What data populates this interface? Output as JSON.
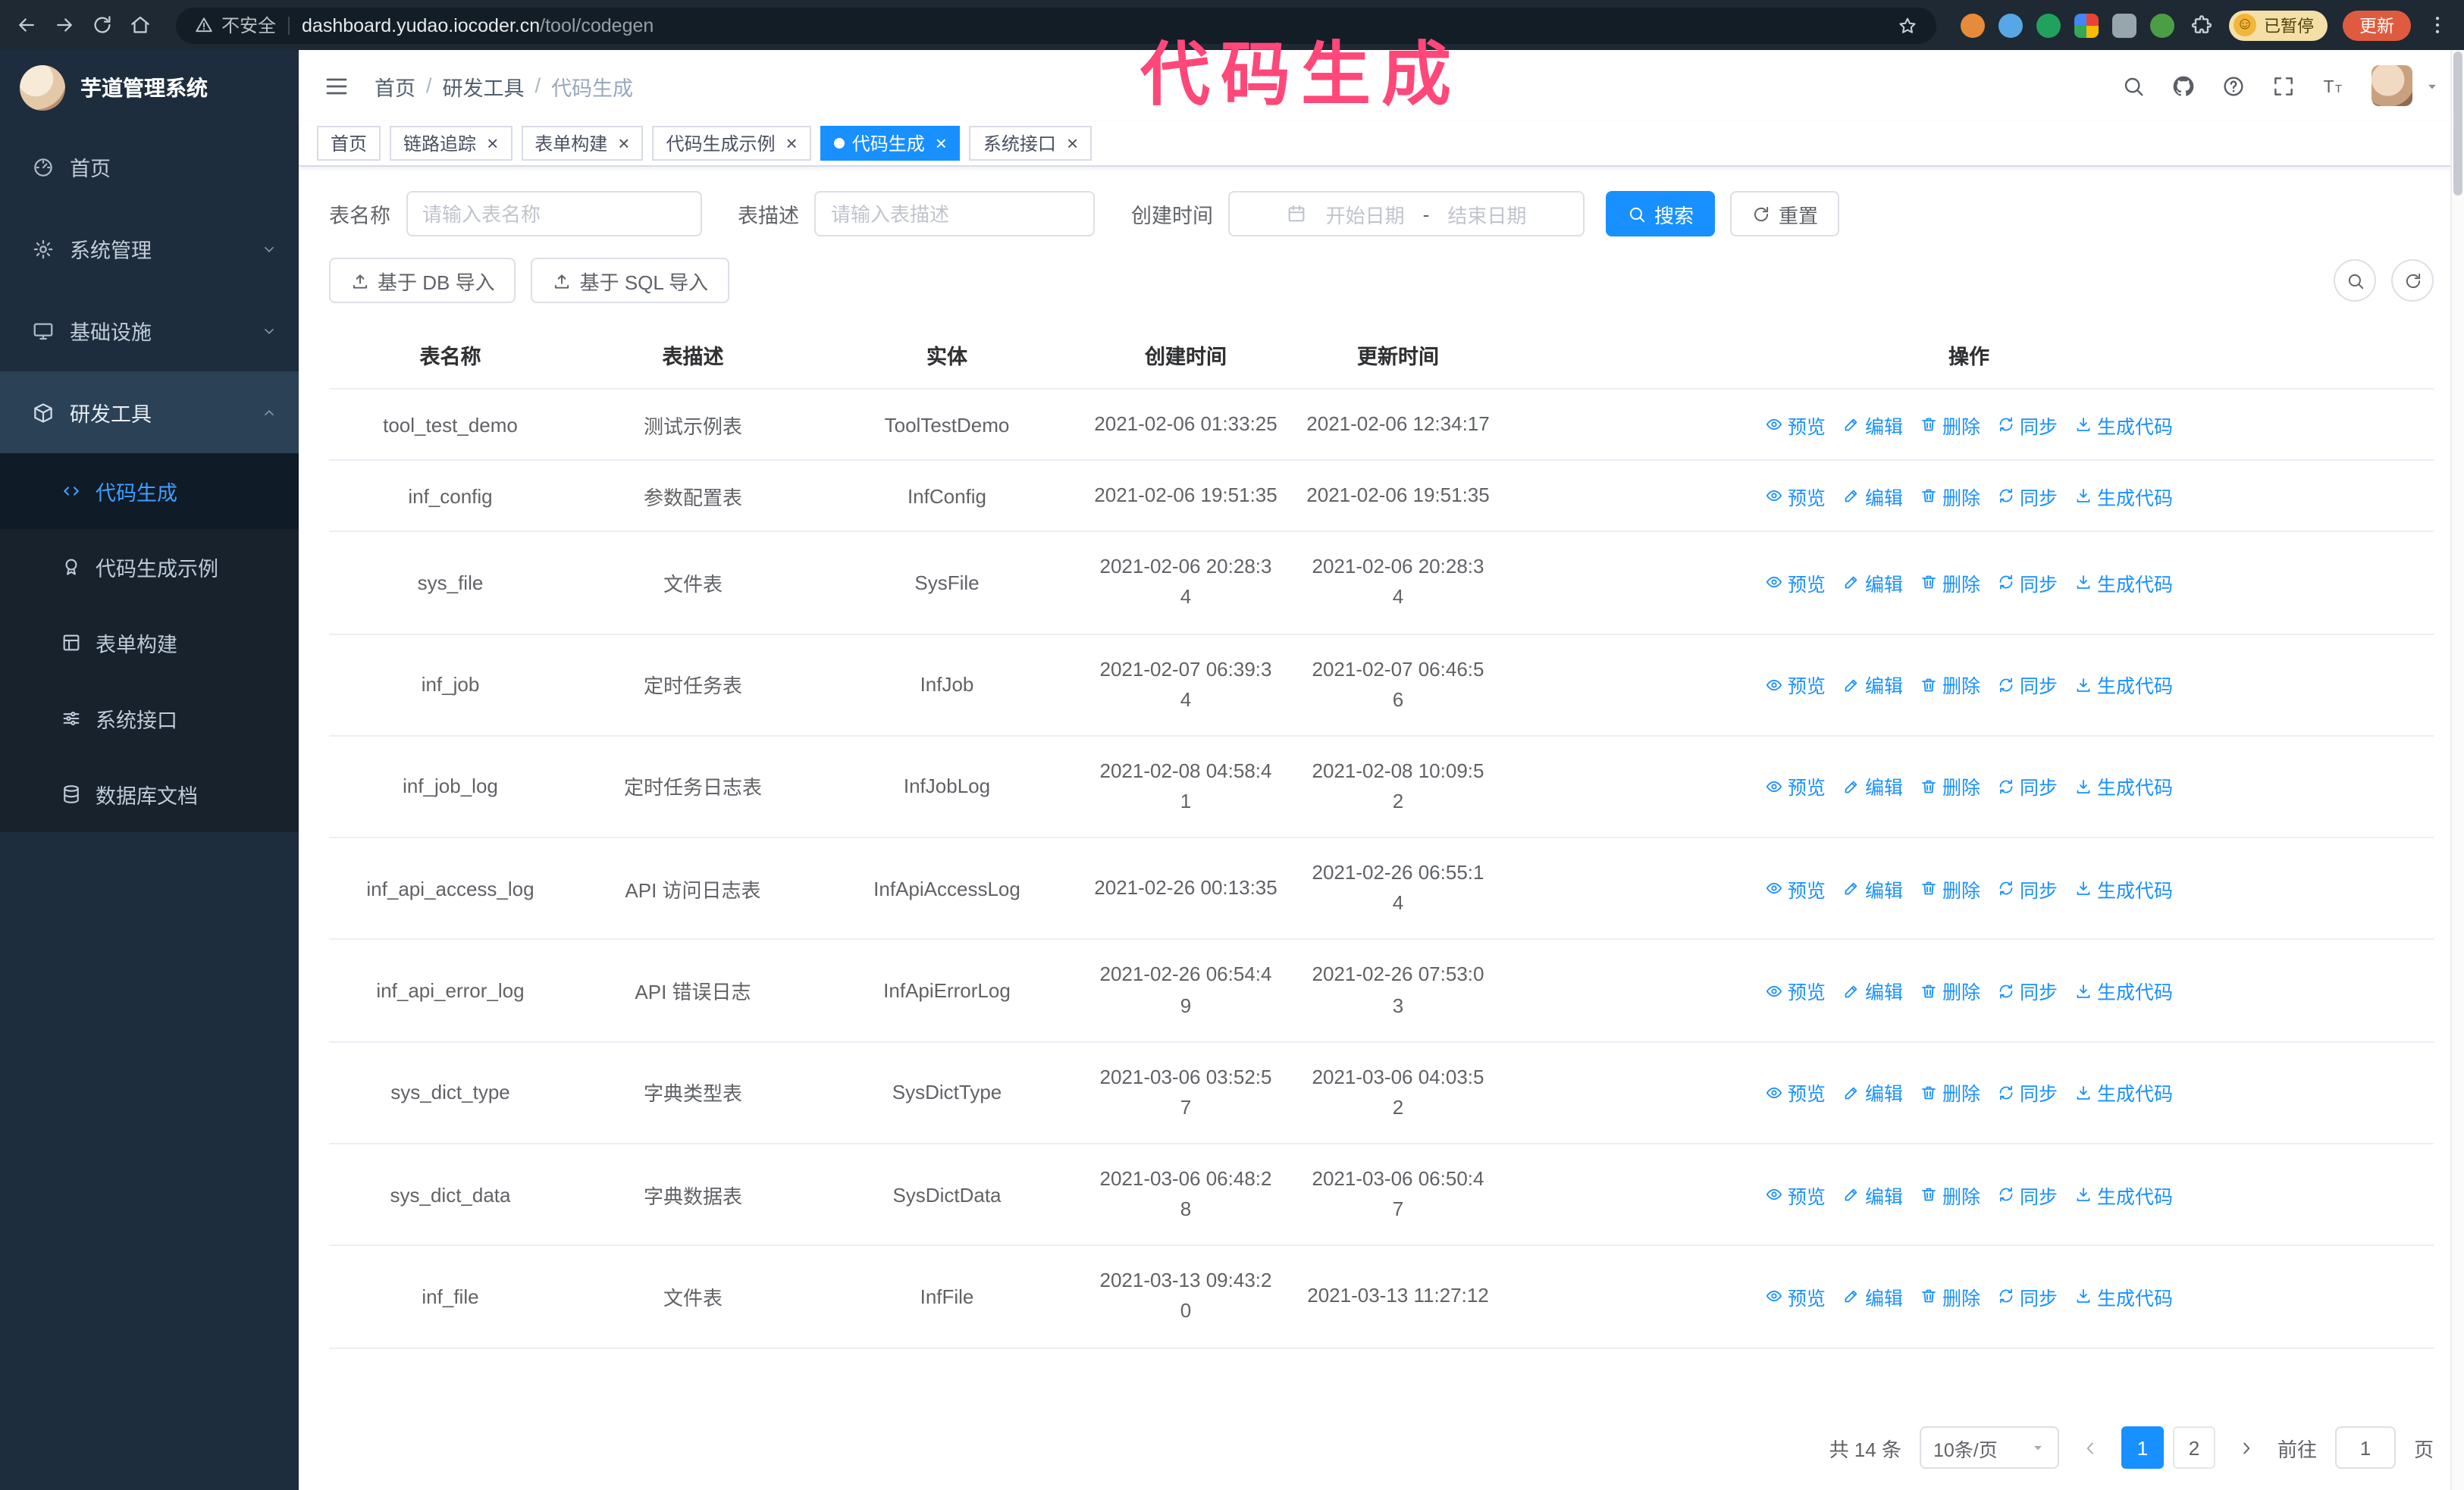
{
  "colors": {
    "accent": "#1890ff",
    "sidebar_active": "#409eff",
    "sidebar_bg": "#1e2d3d",
    "annotation": "#ff4779"
  },
  "annotation": {
    "text": "代码生成"
  },
  "browser": {
    "security_label": "不安全",
    "url_domain": "dashboard.yudao.iocoder.cn",
    "url_path": "/tool/codegen",
    "paused_badge": "已暂停",
    "paused_face": "☺",
    "update_button": "更新",
    "extensions": [
      {
        "name": "orange-extension-icon",
        "color": "#e78b3a",
        "shape": "round"
      },
      {
        "name": "blue-extension-icon",
        "color": "#57a7e6",
        "shape": "round"
      },
      {
        "name": "green-check-extension-icon",
        "color": "#21a15e",
        "shape": "round"
      },
      {
        "name": "multicolor-extension-icon",
        "color": "conic-gradient(#ea4335 0 25%, #fbbc05 0 50%, #34a853 0 75%, #4285f4 0)",
        "shape": "square"
      },
      {
        "name": "gray-extension-icon",
        "color": "#97a5ad",
        "shape": "square"
      },
      {
        "name": "leaf-extension-icon",
        "color": "#4c9e45",
        "shape": "round"
      }
    ]
  },
  "sidebar": {
    "logo_title": "芋道管理系统",
    "items": [
      {
        "key": "home",
        "label": "首页",
        "icon": "dashboard"
      },
      {
        "key": "system-management",
        "label": "系统管理",
        "icon": "gear",
        "chevron": "down"
      },
      {
        "key": "infrastructure",
        "label": "基础设施",
        "icon": "monitor",
        "chevron": "down"
      },
      {
        "key": "dev-tools",
        "label": "研发工具",
        "icon": "tool",
        "chevron": "up",
        "expanded": true,
        "children": [
          {
            "key": "code-generation",
            "label": "代码生成",
            "icon": "code",
            "active": true
          },
          {
            "key": "codegen-example",
            "label": "代码生成示例",
            "icon": "badge"
          },
          {
            "key": "form-builder",
            "label": "表单构建",
            "icon": "form"
          },
          {
            "key": "system-api",
            "label": "系统接口",
            "icon": "api"
          },
          {
            "key": "db-doc",
            "label": "数据库文档",
            "icon": "database"
          }
        ]
      }
    ]
  },
  "header": {
    "breadcrumb": [
      "首页",
      "研发工具",
      "代码生成"
    ],
    "separator": "/"
  },
  "tabs": [
    {
      "key": "home",
      "label": "首页",
      "closable": false,
      "active": false
    },
    {
      "key": "tracer",
      "label": "链路追踪",
      "closable": true,
      "active": false
    },
    {
      "key": "form-builder",
      "label": "表单构建",
      "closable": true,
      "active": false
    },
    {
      "key": "codegen-example",
      "label": "代码生成示例",
      "closable": true,
      "active": false
    },
    {
      "key": "codegen",
      "label": "代码生成",
      "closable": true,
      "active": true
    },
    {
      "key": "system-api",
      "label": "系统接口",
      "closable": true,
      "active": false
    }
  ],
  "filters": {
    "table_name_label": "表名称",
    "table_name_placeholder": "请输入表名称",
    "table_desc_label": "表描述",
    "table_desc_placeholder": "请输入表描述",
    "create_time_label": "创建时间",
    "date_start_placeholder": "开始日期",
    "date_separator": "-",
    "date_end_placeholder": "结束日期",
    "search_button": "搜索",
    "reset_button": "重置"
  },
  "toolbar": {
    "import_db": "基于 DB 导入",
    "import_sql": "基于 SQL 导入"
  },
  "table": {
    "columns": [
      "表名称",
      "表描述",
      "实体",
      "创建时间",
      "更新时间",
      "操作"
    ],
    "row_actions": [
      {
        "key": "preview",
        "label": "预览",
        "icon": "eye"
      },
      {
        "key": "edit",
        "label": "编辑",
        "icon": "edit"
      },
      {
        "key": "delete",
        "label": "删除",
        "icon": "trash"
      },
      {
        "key": "sync",
        "label": "同步",
        "icon": "sync"
      },
      {
        "key": "generate-code",
        "label": "生成代码",
        "icon": "download"
      }
    ],
    "rows": [
      {
        "name": "tool_test_demo",
        "desc": "测试示例表",
        "entity": "ToolTestDemo",
        "created": "2021-02-06 01:33:25",
        "updated": "2021-02-06 12:34:17"
      },
      {
        "name": "inf_config",
        "desc": "参数配置表",
        "entity": "InfConfig",
        "created": "2021-02-06 19:51:35",
        "updated": "2021-02-06 19:51:35"
      },
      {
        "name": "sys_file",
        "desc": "文件表",
        "entity": "SysFile",
        "created": "2021-02-06 20:28:3\n4",
        "updated": "2021-02-06 20:28:3\n4"
      },
      {
        "name": "inf_job",
        "desc": "定时任务表",
        "entity": "InfJob",
        "created": "2021-02-07 06:39:3\n4",
        "updated": "2021-02-07 06:46:5\n6"
      },
      {
        "name": "inf_job_log",
        "desc": "定时任务日志表",
        "entity": "InfJobLog",
        "created": "2021-02-08 04:58:4\n1",
        "updated": "2021-02-08 10:09:5\n2"
      },
      {
        "name": "inf_api_access_log",
        "desc": "API 访问日志表",
        "entity": "InfApiAccessLog",
        "created": "2021-02-26 00:13:35",
        "updated": "2021-02-26 06:55:1\n4"
      },
      {
        "name": "inf_api_error_log",
        "desc": "API 错误日志",
        "entity": "InfApiErrorLog",
        "created": "2021-02-26 06:54:4\n9",
        "updated": "2021-02-26 07:53:0\n3"
      },
      {
        "name": "sys_dict_type",
        "desc": "字典类型表",
        "entity": "SysDictType",
        "created": "2021-03-06 03:52:5\n7",
        "updated": "2021-03-06 04:03:5\n2"
      },
      {
        "name": "sys_dict_data",
        "desc": "字典数据表",
        "entity": "SysDictData",
        "created": "2021-03-06 06:48:2\n8",
        "updated": "2021-03-06 06:50:4\n7"
      },
      {
        "name": "inf_file",
        "desc": "文件表",
        "entity": "InfFile",
        "created": "2021-03-13 09:43:2\n0",
        "updated": "2021-03-13 11:27:12"
      }
    ]
  },
  "pagination": {
    "total_text": "共 14 条",
    "page_size": "10条/页",
    "pages": [
      "1",
      "2"
    ],
    "active_page": "1",
    "goto_label": "前往",
    "goto_value": "1",
    "goto_suffix": "页"
  }
}
